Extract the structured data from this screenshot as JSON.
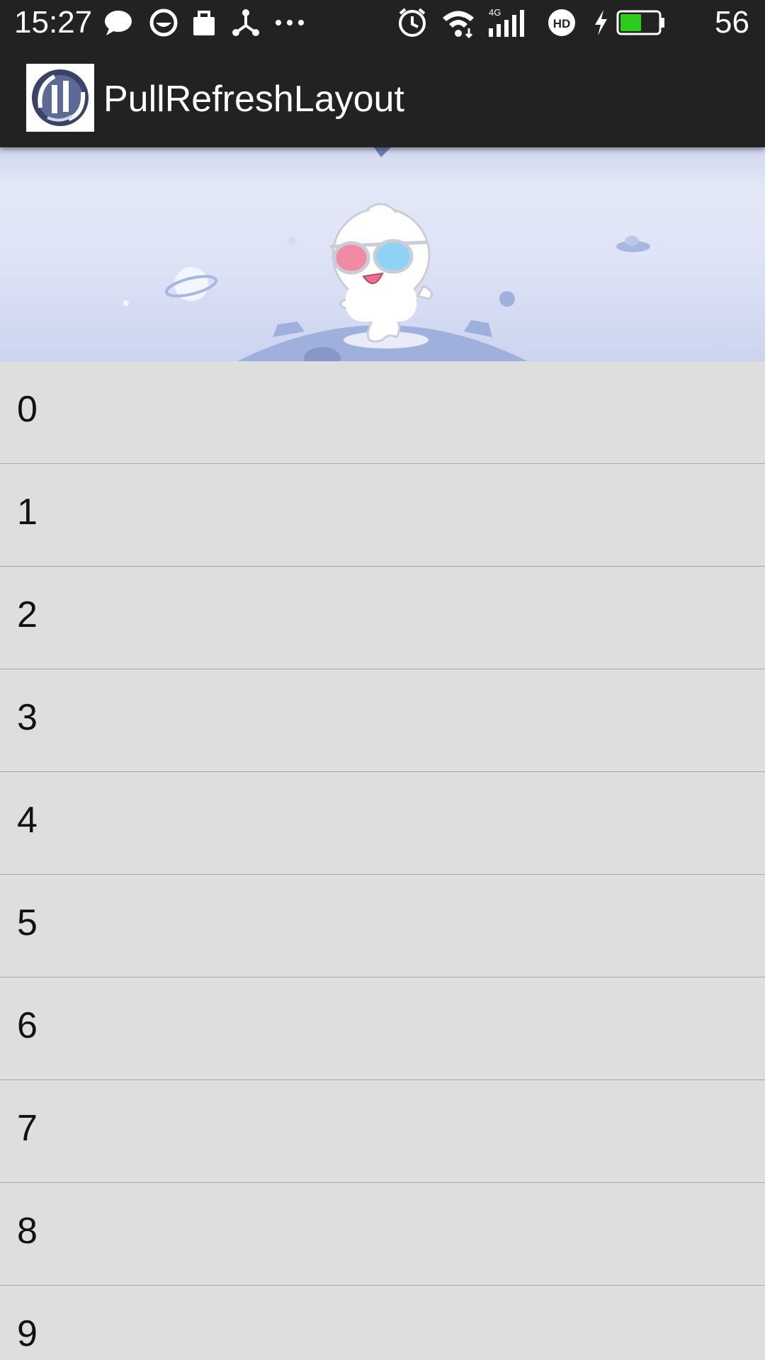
{
  "status_bar": {
    "time": "15:27",
    "battery_level": "56",
    "left_icons": [
      "chat-bubble-icon",
      "sync-icon",
      "shopping-bag-icon",
      "share-hub-icon",
      "more-icon"
    ],
    "right_icons": [
      "alarm-icon",
      "wifi-icon",
      "cellular-4g-icon",
      "hd-voice-icon",
      "charging-icon",
      "battery-icon"
    ],
    "network_label": "4G",
    "hd_label": "HD",
    "battery_color": "#2ecc1a"
  },
  "app_bar": {
    "title": "PullRefreshLayout"
  },
  "refresh_header": {
    "illustration": "mascot-with-3d-glasses-on-planet"
  },
  "list": {
    "items": [
      "0",
      "1",
      "2",
      "3",
      "4",
      "5",
      "6",
      "7",
      "8",
      "9"
    ]
  }
}
